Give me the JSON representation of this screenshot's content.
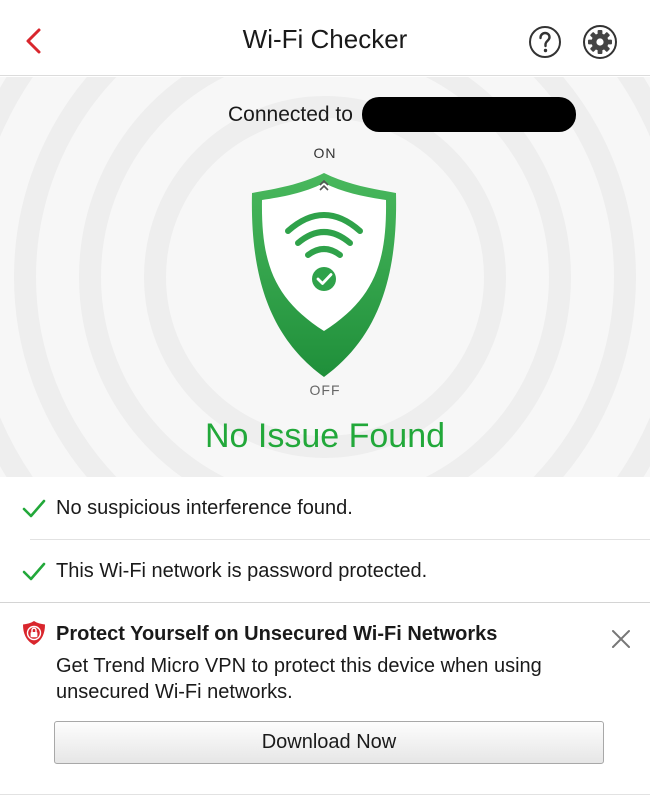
{
  "nav": {
    "title": "Wi-Fi Checker",
    "back_icon": "chevron-left-icon",
    "help_icon": "help-circle-icon",
    "settings_icon": "gear-icon"
  },
  "hero": {
    "connected_label": "Connected to",
    "switch_on_label": "ON",
    "switch_off_label": "OFF",
    "status_text": "No Issue Found",
    "shield_icon": "wifi-shield-icon"
  },
  "checks": [
    {
      "text": "No suspicious interference found.",
      "icon": "check-icon"
    },
    {
      "text": "This Wi-Fi network is password protected.",
      "icon": "check-icon"
    }
  ],
  "promo": {
    "title": "Protect Yourself on Unsecured Wi-Fi Networks",
    "body": "Get Trend Micro VPN to protect this device when using unsecured Wi-Fi networks.",
    "button_label": "Download Now",
    "icon": "vpn-lock-shield-icon",
    "close_icon": "close-icon"
  },
  "colors": {
    "accent_red": "#d9262d",
    "status_green": "#22a83a",
    "shield_green": "#2fa24a"
  }
}
